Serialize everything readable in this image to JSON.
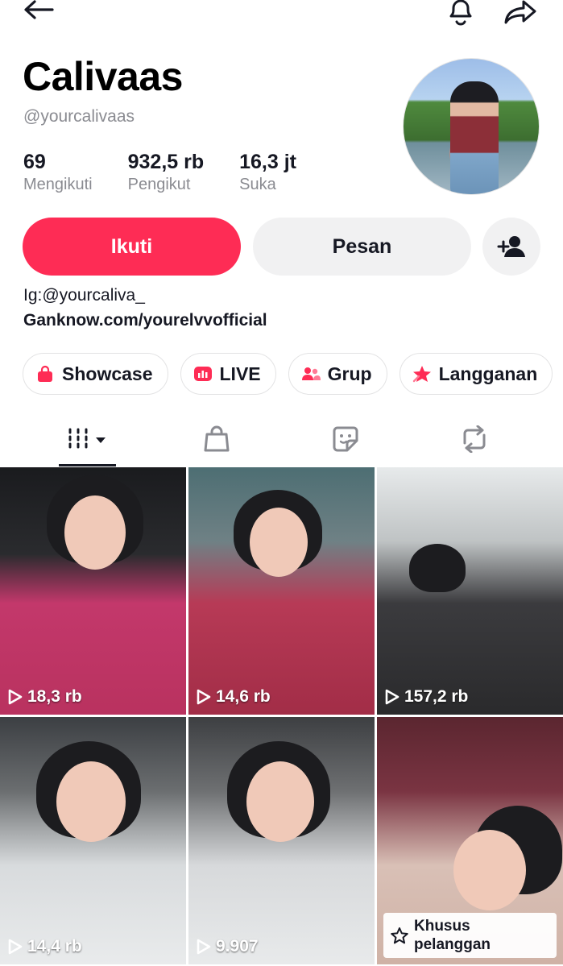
{
  "profile": {
    "name": "Calivaas",
    "handle": "@yourcalivaas",
    "stats": [
      {
        "value": "69",
        "label": "Mengikuti"
      },
      {
        "value": "932,5 rb",
        "label": "Pengikut"
      },
      {
        "value": "16,3 jt",
        "label": "Suka"
      }
    ],
    "bio_line1": "Ig:@yourcaliva_",
    "bio_line2": "Ganknow.com/yourelvvofficial"
  },
  "actions": {
    "follow_label": "Ikuti",
    "message_label": "Pesan"
  },
  "chips": [
    {
      "label": "Showcase",
      "icon": "shopping-bag-icon"
    },
    {
      "label": "LIVE",
      "icon": "live-icon"
    },
    {
      "label": "Grup",
      "icon": "group-icon"
    },
    {
      "label": "Langganan",
      "icon": "subscription-star-icon"
    }
  ],
  "tabs": [
    {
      "icon": "videos-grid-icon",
      "active": true
    },
    {
      "icon": "shop-bag-icon"
    },
    {
      "icon": "sticker-icon"
    },
    {
      "icon": "repost-icon"
    }
  ],
  "videos": [
    {
      "views": "18,3 rb"
    },
    {
      "views": "14,6 rb"
    },
    {
      "views": "157,2 rb"
    },
    {
      "views": "14,4 rb"
    },
    {
      "views": "9.907"
    },
    {
      "badge": "Khusus pelanggan",
      "badge_line1": "Khusus",
      "badge_line2": "pelanggan"
    }
  ],
  "colors": {
    "accent": "#fe2c55",
    "secondary_button": "#f1f1f2",
    "muted_text": "#8a8b91"
  }
}
